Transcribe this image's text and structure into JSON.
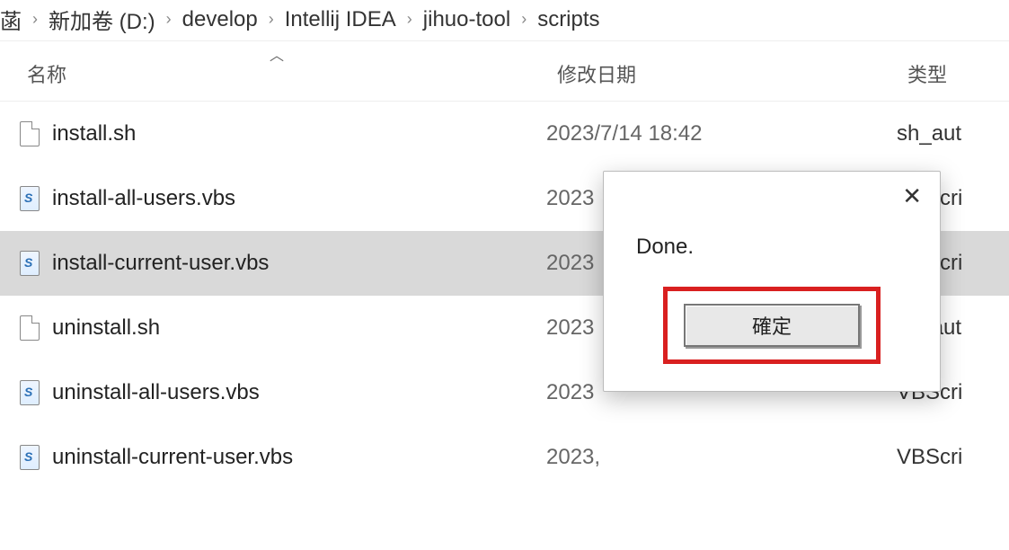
{
  "breadcrumb": [
    "菡",
    "新加卷 (D:)",
    "develop",
    "Intellij IDEA",
    "jihuo-tool",
    "scripts"
  ],
  "columns": {
    "name": "名称",
    "date": "修改日期",
    "type": "类型"
  },
  "files": [
    {
      "name": "install.sh",
      "date": "2023/7/14 18:42",
      "type": "sh_aut",
      "icon": "blank",
      "selected": false
    },
    {
      "name": "install-all-users.vbs",
      "date": "2023",
      "type": "VBScri",
      "icon": "vbs",
      "selected": false
    },
    {
      "name": "install-current-user.vbs",
      "date": "2023",
      "type": "VBScri",
      "icon": "vbs",
      "selected": true
    },
    {
      "name": "uninstall.sh",
      "date": "2023",
      "type": "sh_aut",
      "icon": "blank",
      "selected": false
    },
    {
      "name": "uninstall-all-users.vbs",
      "date": "2023",
      "type": "VBScri",
      "icon": "vbs",
      "selected": false
    },
    {
      "name": "uninstall-current-user.vbs",
      "date": "2023,",
      "type": "VBScri",
      "icon": "vbs",
      "selected": false
    }
  ],
  "dialog": {
    "message": "Done.",
    "ok": "確定"
  }
}
